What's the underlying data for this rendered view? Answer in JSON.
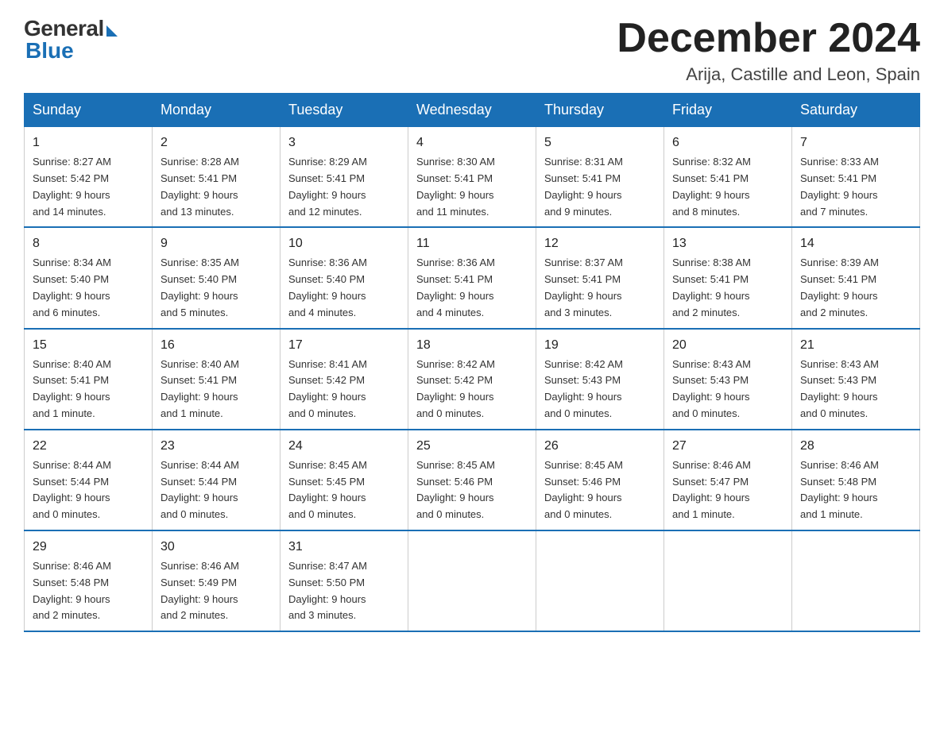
{
  "logo": {
    "general": "General",
    "blue": "Blue"
  },
  "title": "December 2024",
  "subtitle": "Arija, Castille and Leon, Spain",
  "days_header": [
    "Sunday",
    "Monday",
    "Tuesday",
    "Wednesday",
    "Thursday",
    "Friday",
    "Saturday"
  ],
  "weeks": [
    [
      {
        "day": "1",
        "info": "Sunrise: 8:27 AM\nSunset: 5:42 PM\nDaylight: 9 hours\nand 14 minutes."
      },
      {
        "day": "2",
        "info": "Sunrise: 8:28 AM\nSunset: 5:41 PM\nDaylight: 9 hours\nand 13 minutes."
      },
      {
        "day": "3",
        "info": "Sunrise: 8:29 AM\nSunset: 5:41 PM\nDaylight: 9 hours\nand 12 minutes."
      },
      {
        "day": "4",
        "info": "Sunrise: 8:30 AM\nSunset: 5:41 PM\nDaylight: 9 hours\nand 11 minutes."
      },
      {
        "day": "5",
        "info": "Sunrise: 8:31 AM\nSunset: 5:41 PM\nDaylight: 9 hours\nand 9 minutes."
      },
      {
        "day": "6",
        "info": "Sunrise: 8:32 AM\nSunset: 5:41 PM\nDaylight: 9 hours\nand 8 minutes."
      },
      {
        "day": "7",
        "info": "Sunrise: 8:33 AM\nSunset: 5:41 PM\nDaylight: 9 hours\nand 7 minutes."
      }
    ],
    [
      {
        "day": "8",
        "info": "Sunrise: 8:34 AM\nSunset: 5:40 PM\nDaylight: 9 hours\nand 6 minutes."
      },
      {
        "day": "9",
        "info": "Sunrise: 8:35 AM\nSunset: 5:40 PM\nDaylight: 9 hours\nand 5 minutes."
      },
      {
        "day": "10",
        "info": "Sunrise: 8:36 AM\nSunset: 5:40 PM\nDaylight: 9 hours\nand 4 minutes."
      },
      {
        "day": "11",
        "info": "Sunrise: 8:36 AM\nSunset: 5:41 PM\nDaylight: 9 hours\nand 4 minutes."
      },
      {
        "day": "12",
        "info": "Sunrise: 8:37 AM\nSunset: 5:41 PM\nDaylight: 9 hours\nand 3 minutes."
      },
      {
        "day": "13",
        "info": "Sunrise: 8:38 AM\nSunset: 5:41 PM\nDaylight: 9 hours\nand 2 minutes."
      },
      {
        "day": "14",
        "info": "Sunrise: 8:39 AM\nSunset: 5:41 PM\nDaylight: 9 hours\nand 2 minutes."
      }
    ],
    [
      {
        "day": "15",
        "info": "Sunrise: 8:40 AM\nSunset: 5:41 PM\nDaylight: 9 hours\nand 1 minute."
      },
      {
        "day": "16",
        "info": "Sunrise: 8:40 AM\nSunset: 5:41 PM\nDaylight: 9 hours\nand 1 minute."
      },
      {
        "day": "17",
        "info": "Sunrise: 8:41 AM\nSunset: 5:42 PM\nDaylight: 9 hours\nand 0 minutes."
      },
      {
        "day": "18",
        "info": "Sunrise: 8:42 AM\nSunset: 5:42 PM\nDaylight: 9 hours\nand 0 minutes."
      },
      {
        "day": "19",
        "info": "Sunrise: 8:42 AM\nSunset: 5:43 PM\nDaylight: 9 hours\nand 0 minutes."
      },
      {
        "day": "20",
        "info": "Sunrise: 8:43 AM\nSunset: 5:43 PM\nDaylight: 9 hours\nand 0 minutes."
      },
      {
        "day": "21",
        "info": "Sunrise: 8:43 AM\nSunset: 5:43 PM\nDaylight: 9 hours\nand 0 minutes."
      }
    ],
    [
      {
        "day": "22",
        "info": "Sunrise: 8:44 AM\nSunset: 5:44 PM\nDaylight: 9 hours\nand 0 minutes."
      },
      {
        "day": "23",
        "info": "Sunrise: 8:44 AM\nSunset: 5:44 PM\nDaylight: 9 hours\nand 0 minutes."
      },
      {
        "day": "24",
        "info": "Sunrise: 8:45 AM\nSunset: 5:45 PM\nDaylight: 9 hours\nand 0 minutes."
      },
      {
        "day": "25",
        "info": "Sunrise: 8:45 AM\nSunset: 5:46 PM\nDaylight: 9 hours\nand 0 minutes."
      },
      {
        "day": "26",
        "info": "Sunrise: 8:45 AM\nSunset: 5:46 PM\nDaylight: 9 hours\nand 0 minutes."
      },
      {
        "day": "27",
        "info": "Sunrise: 8:46 AM\nSunset: 5:47 PM\nDaylight: 9 hours\nand 1 minute."
      },
      {
        "day": "28",
        "info": "Sunrise: 8:46 AM\nSunset: 5:48 PM\nDaylight: 9 hours\nand 1 minute."
      }
    ],
    [
      {
        "day": "29",
        "info": "Sunrise: 8:46 AM\nSunset: 5:48 PM\nDaylight: 9 hours\nand 2 minutes."
      },
      {
        "day": "30",
        "info": "Sunrise: 8:46 AM\nSunset: 5:49 PM\nDaylight: 9 hours\nand 2 minutes."
      },
      {
        "day": "31",
        "info": "Sunrise: 8:47 AM\nSunset: 5:50 PM\nDaylight: 9 hours\nand 3 minutes."
      },
      {
        "day": "",
        "info": ""
      },
      {
        "day": "",
        "info": ""
      },
      {
        "day": "",
        "info": ""
      },
      {
        "day": "",
        "info": ""
      }
    ]
  ]
}
